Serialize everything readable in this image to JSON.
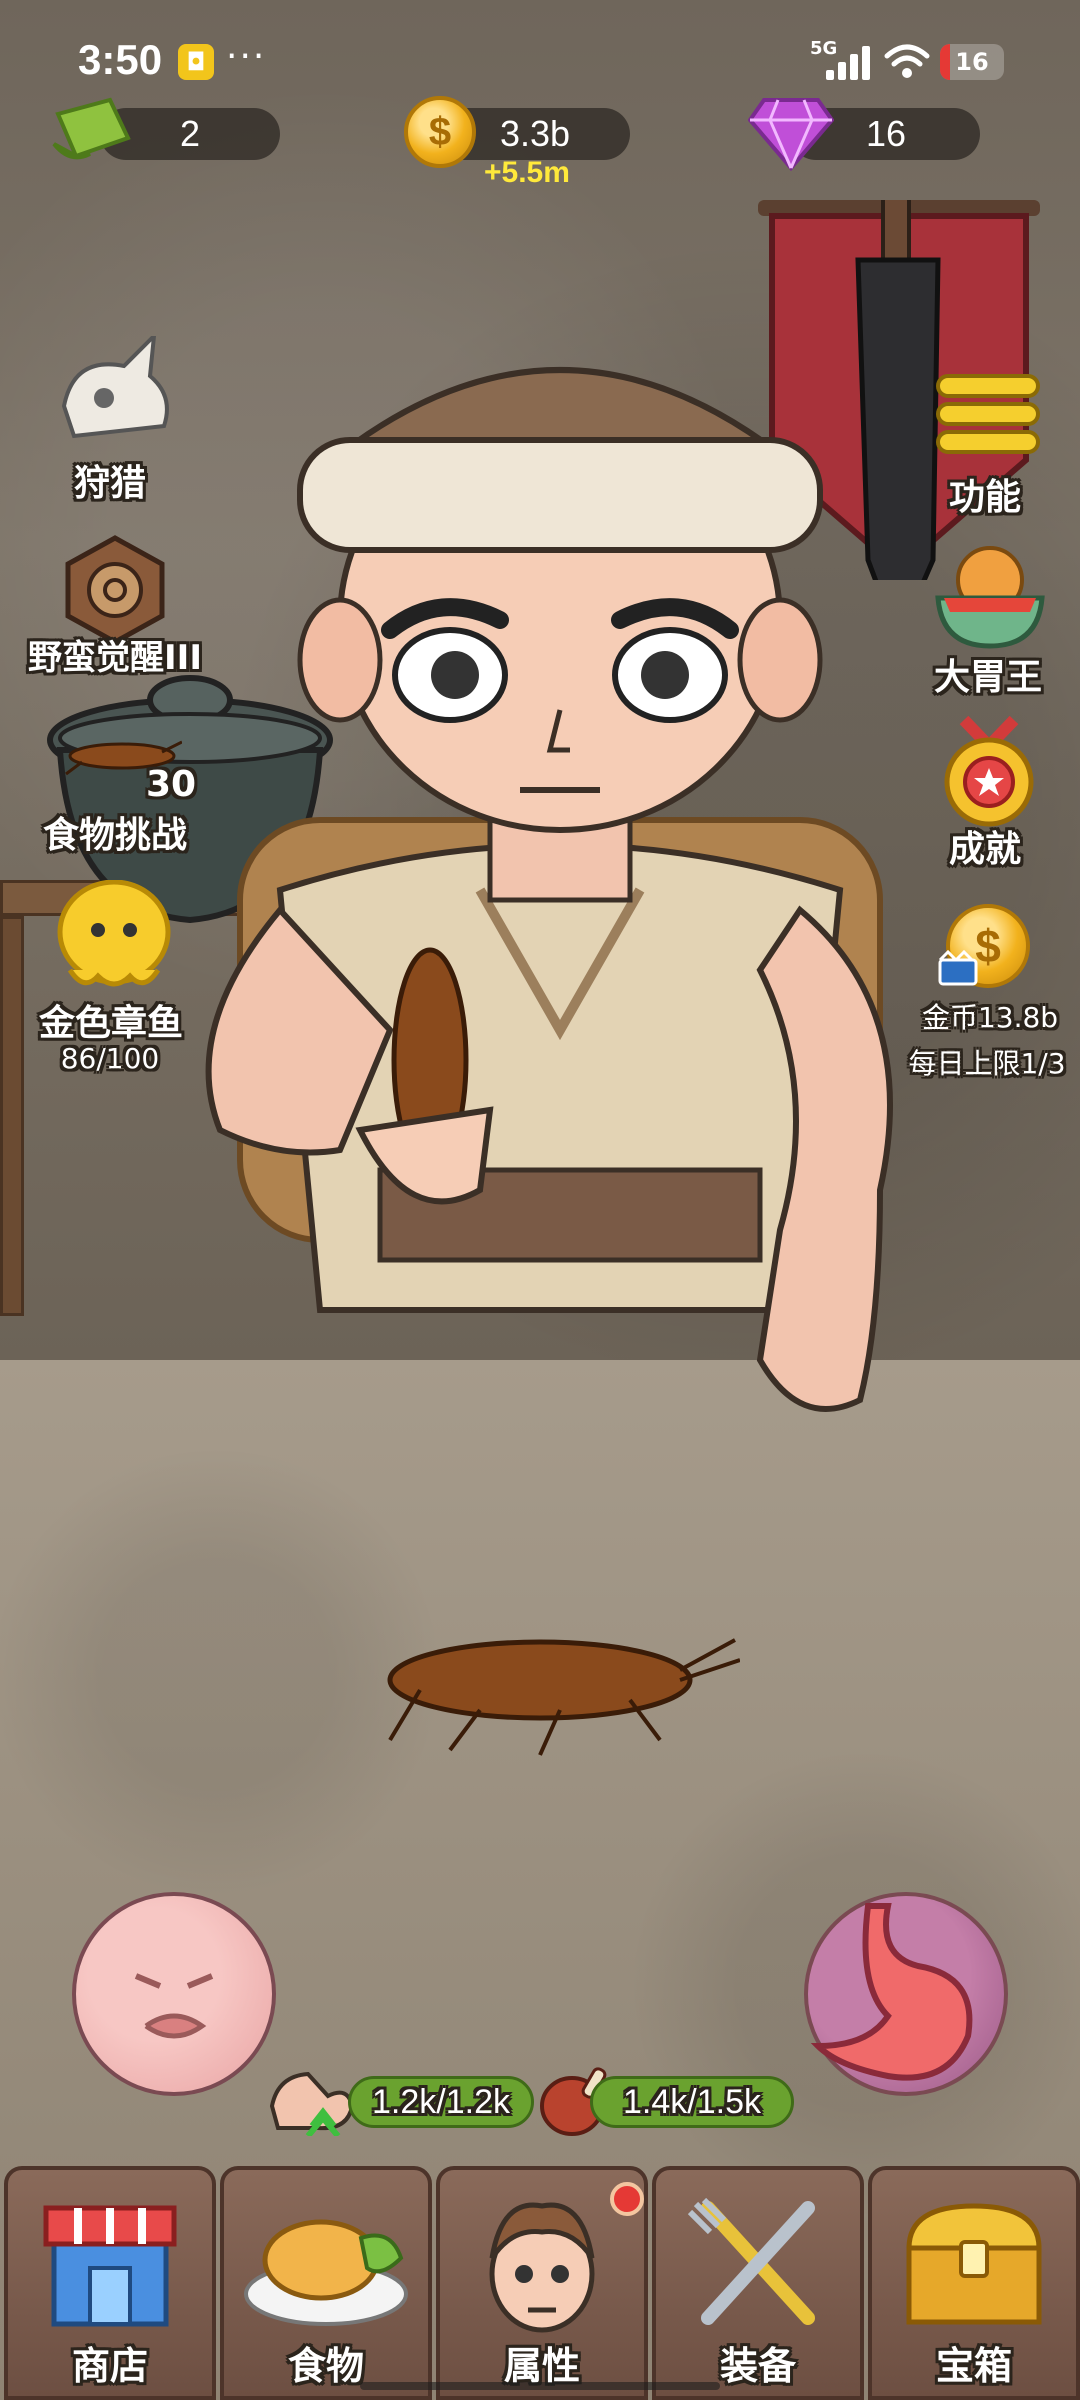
{
  "status_bar": {
    "time": "3:50",
    "more": "···",
    "network": "5G",
    "battery_level": "16",
    "battery_fraction": 0.16
  },
  "currencies": {
    "tickets": "2",
    "gold": "3.3b",
    "gold_income": "+5.5m",
    "gems": "16"
  },
  "left_menu": {
    "hunt": "狩猎",
    "awaken": "野蛮觉醒III",
    "food_challenge_count": "30",
    "food_challenge": "食物挑战",
    "golden_octopus": "金色章鱼",
    "golden_octopus_progress": "86/100"
  },
  "right_menu": {
    "functions": "功能",
    "big_eater": "大胃王",
    "achievements": "成就",
    "ad_reward": "金币13.8b",
    "ad_limit": "每日上限1/3"
  },
  "stats": {
    "strength": "1.2k/1.2k",
    "hunger": "1.4k/1.5k"
  },
  "nav": {
    "shop": "商店",
    "food": "食物",
    "attributes": "属性",
    "equipment": "装备",
    "chest": "宝箱"
  },
  "colors": {
    "gold_income": "#ffe93b",
    "stat_pill": "#6aa22f",
    "badge": "#e53935",
    "banner": "#a8323a"
  }
}
